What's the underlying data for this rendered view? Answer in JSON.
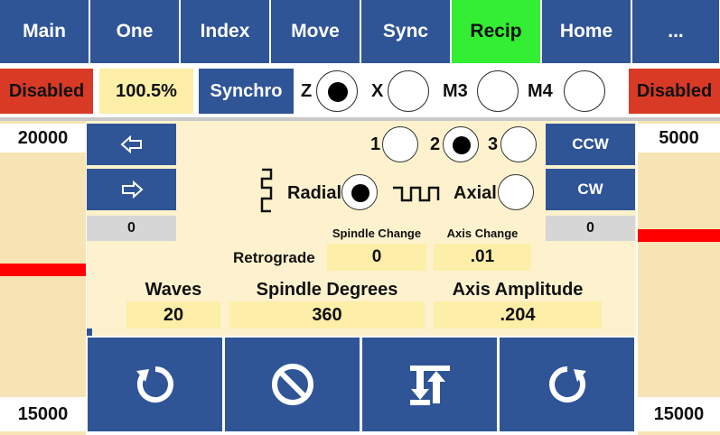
{
  "tabs": [
    {
      "label": "Main"
    },
    {
      "label": "One"
    },
    {
      "label": "Index"
    },
    {
      "label": "Move"
    },
    {
      "label": "Sync"
    },
    {
      "label": "Recip",
      "active": true
    },
    {
      "label": "Home"
    },
    {
      "label": "..."
    }
  ],
  "status_row": {
    "left_status": "Disabled",
    "percent": "100.5%",
    "synchro_label": "Synchro",
    "axes": [
      {
        "label": "Z",
        "selected": true
      },
      {
        "label": "X",
        "selected": false
      },
      {
        "label": "M3",
        "selected": false
      },
      {
        "label": "M4",
        "selected": false
      }
    ],
    "right_status": "Disabled"
  },
  "left_gauge": {
    "top_value": "20000",
    "bottom_value": "15000"
  },
  "right_gauge": {
    "top_value": "5000",
    "bottom_value": "15000"
  },
  "controls": {
    "left_arrow_icon": "arrow-left-icon",
    "right_arrow_icon": "arrow-right-icon",
    "left_counter": "0",
    "right_counter": "0",
    "ccw_label": "CCW",
    "cw_label": "CW",
    "wave_count": [
      {
        "label": "1",
        "selected": false
      },
      {
        "label": "2",
        "selected": true
      },
      {
        "label": "3",
        "selected": false
      }
    ],
    "radial_label": "Radial",
    "axial_label": "Axial",
    "radial_selected": true,
    "axial_selected": false
  },
  "params": {
    "retrograde_label": "Retrograde",
    "spindle_change_label": "Spindle Change",
    "spindle_change_value": "0",
    "axis_change_label": "Axis Change",
    "axis_change_value": ".01",
    "waves_label": "Waves",
    "waves_value": "20",
    "spindle_degrees_label": "Spindle Degrees",
    "spindle_degrees_value": "360",
    "axis_amplitude_label": "Axis Amplitude",
    "axis_amplitude_value": ".204"
  },
  "bottom_buttons": [
    {
      "icon": "rotate-ccw-icon"
    },
    {
      "icon": "stop-icon"
    },
    {
      "icon": "sort-ascending-icon"
    },
    {
      "icon": "rotate-cw-icon"
    }
  ],
  "colors": {
    "tab_blue": "#2f5597",
    "active_green": "#33ee33",
    "status_red": "#d83a26",
    "value_yellow": "#fdeea8",
    "panel_cream": "#fdf2cd",
    "marker_red": "#ff0000"
  }
}
